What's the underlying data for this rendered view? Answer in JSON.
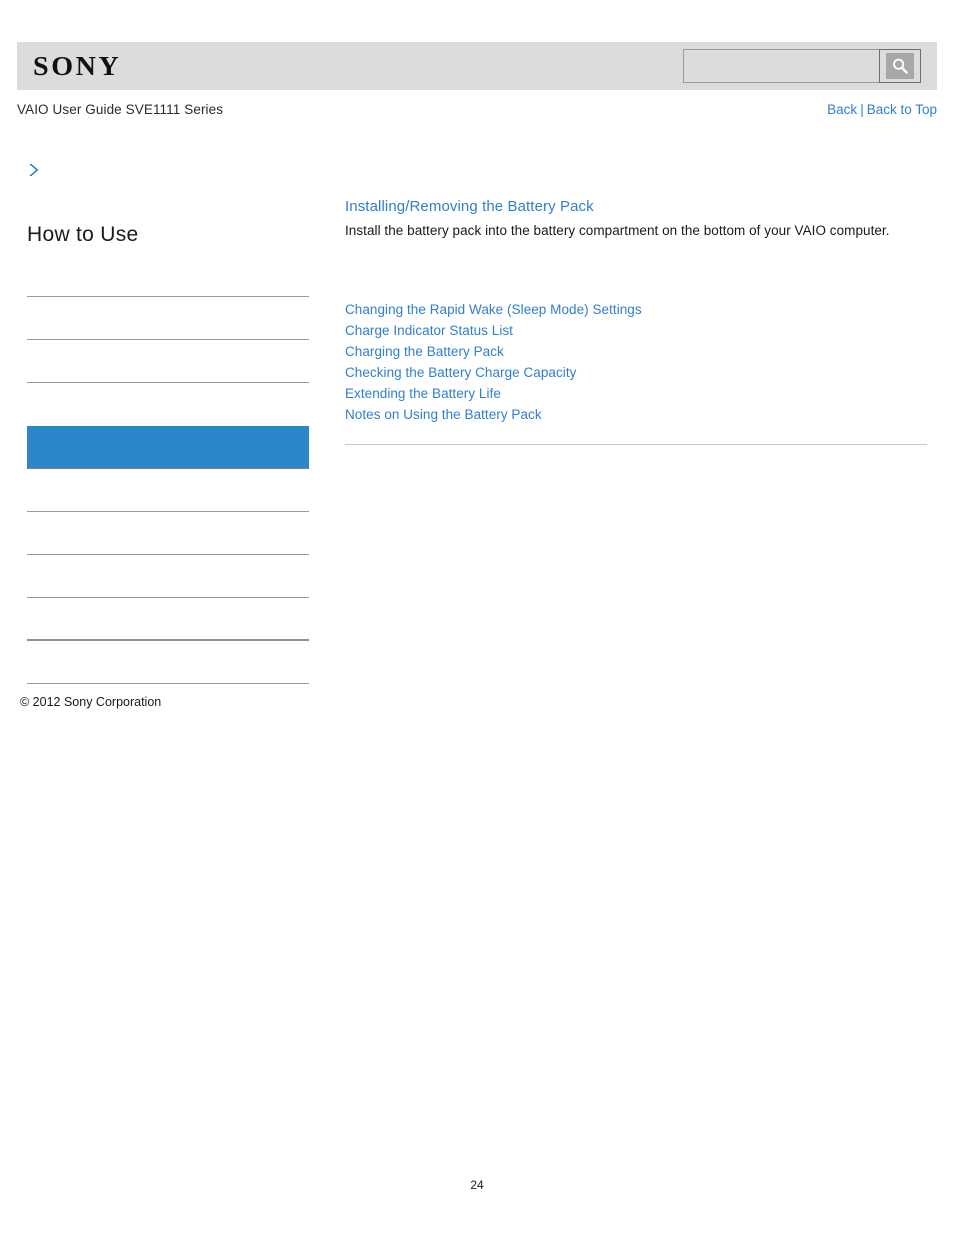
{
  "header": {
    "logo_text": "SONY",
    "search": {
      "value": "",
      "placeholder": "",
      "icon": "search-icon"
    }
  },
  "titlebar": {
    "guide_title": "VAIO User Guide SVE1111 Series",
    "back_label": "Back",
    "separator": "|",
    "back_to_top_label": "Back to Top"
  },
  "sidebar": {
    "arrow_icon": "chevron-right-icon",
    "section_title": "How to Use",
    "items": [
      {
        "label": ""
      },
      {
        "label": ""
      },
      {
        "label": ""
      },
      {
        "label": ""
      },
      {
        "label": ""
      },
      {
        "label": ""
      },
      {
        "label": ""
      },
      {
        "label": ""
      },
      {
        "label": ""
      },
      {
        "label": ""
      }
    ],
    "selected_index": 4,
    "copyright": "© 2012 Sony Corporation"
  },
  "main": {
    "topic_title": "Installing/Removing the Battery Pack",
    "topic_description": "Install the battery pack into the battery compartment on the bottom of your VAIO computer.",
    "related_links": [
      "Changing the Rapid Wake (Sleep Mode) Settings",
      "Charge Indicator Status List",
      "Charging the Battery Pack",
      "Checking the Battery Charge Capacity",
      "Extending the Battery Life",
      "Notes on Using the Battery Pack"
    ]
  },
  "footer": {
    "page_number": "24"
  },
  "colors": {
    "link_blue": "#2f7fd0",
    "accent_blue": "#2b87c8",
    "header_gray": "#dcdcdc",
    "rule_gray": "#9a9a9a"
  }
}
